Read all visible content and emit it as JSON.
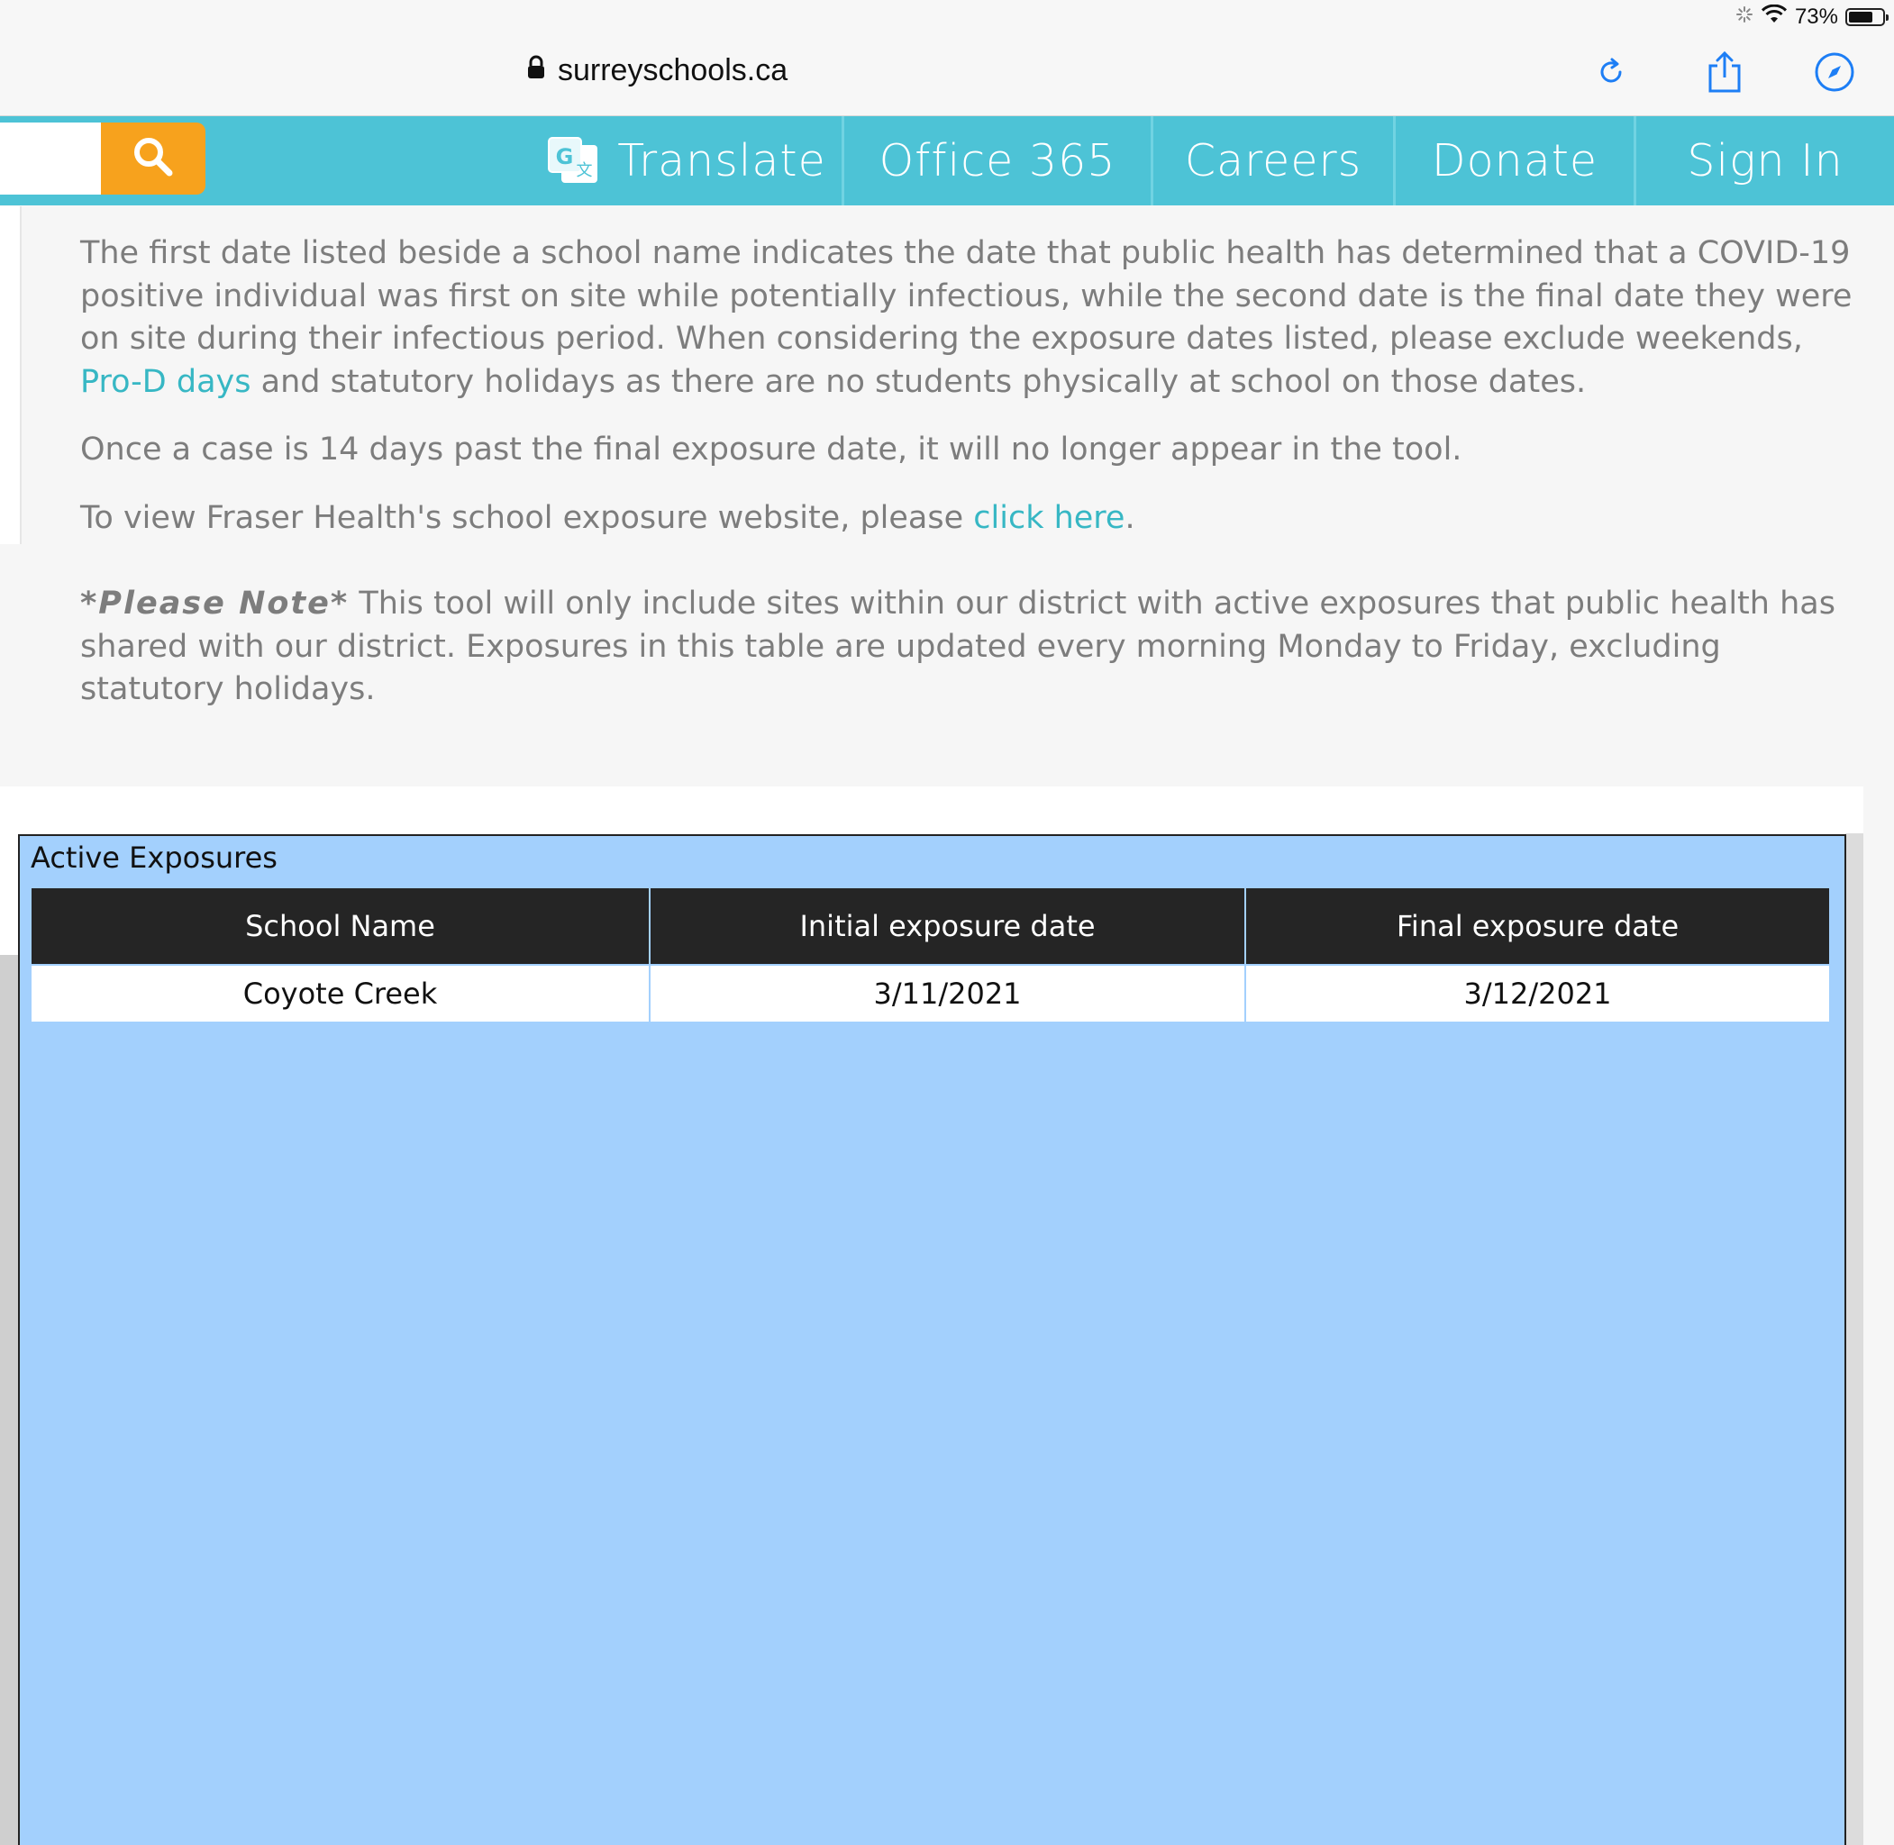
{
  "status_bar": {
    "battery_percent_text": "73%",
    "battery_level": 0.73
  },
  "browser": {
    "url": "surreyschools.ca",
    "icons": [
      "lock-icon",
      "reload-icon",
      "share-icon",
      "compass-icon"
    ]
  },
  "nav": {
    "items": [
      {
        "label": "Translate",
        "icon": "translate-icon"
      },
      {
        "label": "Office 365"
      },
      {
        "label": "Careers"
      },
      {
        "label": "Donate"
      },
      {
        "label": "Sign In"
      }
    ],
    "search_icon": "search-icon"
  },
  "content": {
    "p1_a": "The first date listed beside a school name indicates the date that public health has determined that a COVID-19 positive individual was first on site while potentially infectious, while the second date is the final date they were on site during their infectious period. When considering the exposure dates listed, please exclude weekends, ",
    "p1_link": "Pro-D days",
    "p1_b": " and statutory holidays as there are no students physically at school on those dates.",
    "p2": "Once a case is 14 days past the final exposure date, it will no longer appear in the tool.",
    "p3_a": "To view Fraser Health's school exposure website, please ",
    "p3_link": "click here",
    "p3_b": ".",
    "note_label": "*Please Note*",
    "note_text": " This tool will only include sites within our district with active exposures that public health has shared with our district. Exposures in this table are updated every morning Monday to Friday, excluding statutory holidays."
  },
  "report": {
    "title": "Active Exposures",
    "columns": [
      "School Name",
      "Initial exposure date",
      "Final exposure date"
    ],
    "rows": [
      [
        "Coyote Creek",
        "3/11/2021",
        "3/12/2021"
      ]
    ]
  },
  "colors": {
    "nav_bg": "#4dc3d6",
    "search_btn": "#f7a21d",
    "link": "#37b7c4",
    "report_bg": "#a3d0fd",
    "header_bg": "#252525"
  }
}
